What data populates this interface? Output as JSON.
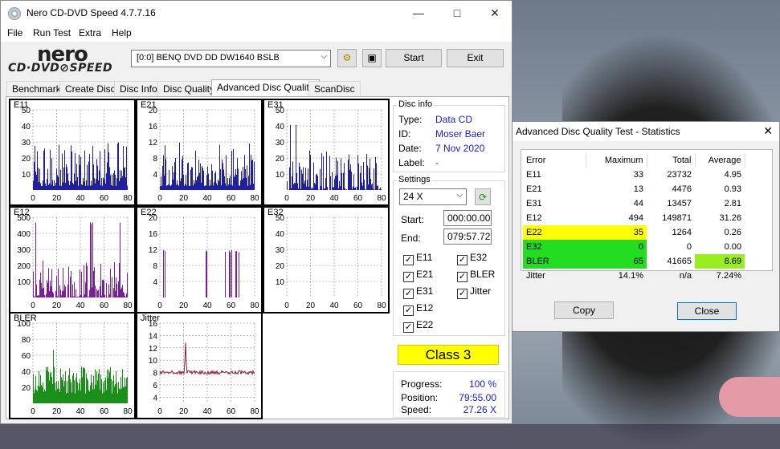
{
  "background": {
    "desc_colors": [
      "#6d7a8a",
      "#161616",
      "#e39aa6"
    ]
  },
  "main_window": {
    "title": "Nero CD-DVD Speed 4.7.7.16",
    "menu": [
      "File",
      "Run Test",
      "Extra",
      "Help"
    ],
    "logo_top": "nero",
    "logo_bottom": "CD·DVD⊘SPEED",
    "drive": "[0:0]   BENQ DVD DD DW1640 BSLB",
    "start_label": "Start",
    "exit_label": "Exit",
    "tabs": [
      "Benchmark",
      "Create Disc",
      "Disc Info",
      "Disc Quality",
      "Advanced Disc Quality",
      "ScanDisc"
    ],
    "active_tab": "Advanced Disc Quality"
  },
  "disc_info": {
    "title": "Disc info",
    "type_label": "Type:",
    "type": "Data CD",
    "id_label": "ID:",
    "id": "Moser Baer",
    "date_label": "Date:",
    "date": "7 Nov 2020",
    "label_label": "Label:",
    "label": "-"
  },
  "settings": {
    "title": "Settings",
    "speed": "24 X",
    "start_label": "Start:",
    "start": "000:00.00",
    "end_label": "End:",
    "end": "079:57.72",
    "checks": [
      {
        "name": "E11",
        "on": true
      },
      {
        "name": "E32",
        "on": true
      },
      {
        "name": "E21",
        "on": true
      },
      {
        "name": "BLER",
        "on": true
      },
      {
        "name": "E31",
        "on": true
      },
      {
        "name": "Jitter",
        "on": true
      },
      {
        "name": "E12",
        "on": true
      },
      {
        "name": "E22",
        "on": true
      }
    ]
  },
  "class_label": "Class 3",
  "progress": {
    "progress_label": "Progress:",
    "progress": "100 %",
    "position_label": "Position:",
    "position": "79:55.00",
    "speed_label": "Speed:",
    "speed": "27.26 X"
  },
  "charts": [
    {
      "name": "E11",
      "ymax": 50,
      "yticks": [
        "50",
        "40",
        "30",
        "20",
        "10"
      ],
      "xticks": [
        "0",
        "20",
        "40",
        "60",
        "80"
      ],
      "color": "#1f1f9f"
    },
    {
      "name": "E21",
      "ymax": 20,
      "yticks": [
        "20",
        "16",
        "12",
        "8",
        "4"
      ],
      "xticks": [
        "0",
        "20",
        "40",
        "60",
        "80"
      ],
      "color": "#1f1f9f"
    },
    {
      "name": "E31",
      "ymax": 50,
      "yticks": [
        "50",
        "40",
        "30",
        "20",
        "10"
      ],
      "xticks": [
        "0",
        "20",
        "40",
        "60",
        "80"
      ],
      "color": "#1f1f9f"
    },
    {
      "name": "E12",
      "ymax": 500,
      "yticks": [
        "500",
        "400",
        "300",
        "200",
        "100"
      ],
      "xticks": [
        "0",
        "20",
        "40",
        "60",
        "80"
      ],
      "color": "#7a1f9a"
    },
    {
      "name": "E22",
      "ymax": 20,
      "yticks": [
        "20",
        "16",
        "12",
        "8",
        "4"
      ],
      "xticks": [
        "0",
        "20",
        "40",
        "60",
        "80"
      ],
      "color": "#7a1f9a"
    },
    {
      "name": "E32",
      "ymax": 50,
      "yticks": [
        "50",
        "40",
        "30",
        "20",
        "10"
      ],
      "xticks": [
        "0",
        "20",
        "40",
        "60",
        "80"
      ],
      "color": "#7a1f9a"
    },
    {
      "name": "BLER",
      "ymax": 100,
      "yticks": [
        "100",
        "80",
        "60",
        "40",
        "20"
      ],
      "xticks": [
        "0",
        "20",
        "40",
        "60",
        "80"
      ],
      "color": "#1a8f1a"
    },
    {
      "name": "Jitter",
      "ymax": 16,
      "yticks": [
        "16",
        "14",
        "12",
        "10",
        "8",
        "6",
        "4"
      ],
      "xticks": [
        "0",
        "20",
        "40",
        "60",
        "80"
      ],
      "color": "#8a1f3a"
    }
  ],
  "stats": {
    "title": "Advanced Disc Quality Test - Statistics",
    "headers": [
      "Error",
      "Maximum",
      "Total",
      "Average"
    ],
    "rows": [
      {
        "error": "E11",
        "max": "33",
        "total": "23732",
        "avg": "4.95"
      },
      {
        "error": "E21",
        "max": "13",
        "total": "4476",
        "avg": "0.93"
      },
      {
        "error": "E31",
        "max": "44",
        "total": "13457",
        "avg": "2.81"
      },
      {
        "error": "E12",
        "max": "494",
        "total": "149871",
        "avg": "31.26"
      },
      {
        "error": "E22",
        "max": "35",
        "total": "1264",
        "avg": "0.26"
      },
      {
        "error": "E32",
        "max": "0",
        "total": "0",
        "avg": "0.00"
      },
      {
        "error": "BLER",
        "max": "65",
        "total": "41665",
        "avg": "8.69"
      },
      {
        "error": "Jitter",
        "max": "14.1%",
        "total": "n/a",
        "avg": "7.24%"
      }
    ],
    "copy_label": "Copy",
    "close_label": "Close"
  }
}
